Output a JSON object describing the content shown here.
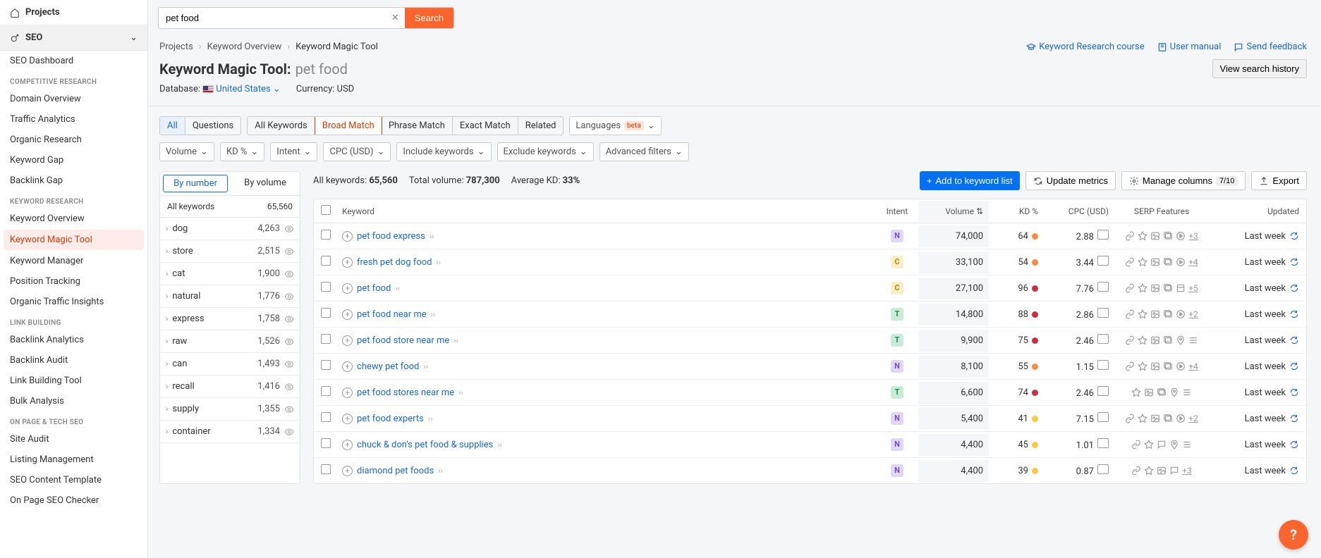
{
  "sidebar": {
    "projects_label": "Projects",
    "seo_label": "SEO",
    "items": {
      "dashboard": "SEO Dashboard",
      "sec_comp": "COMPETITIVE RESEARCH",
      "domain_ov": "Domain Overview",
      "traffic": "Traffic Analytics",
      "organic": "Organic Research",
      "kw_gap": "Keyword Gap",
      "bl_gap": "Backlink Gap",
      "sec_kw": "KEYWORD RESEARCH",
      "kw_ov": "Keyword Overview",
      "kw_magic": "Keyword Magic Tool",
      "kw_mgr": "Keyword Manager",
      "pos_track": "Position Tracking",
      "org_ins": "Organic Traffic Insights",
      "sec_lb": "LINK BUILDING",
      "bl_an": "Backlink Analytics",
      "bl_audit": "Backlink Audit",
      "lb_tool": "Link Building Tool",
      "bulk": "Bulk Analysis",
      "sec_op": "ON PAGE & TECH SEO",
      "site_audit": "Site Audit",
      "listing": "Listing Management",
      "seo_ct": "SEO Content Template",
      "op_checker": "On Page SEO Checker"
    }
  },
  "topbar": {
    "search_value": "pet food",
    "search_btn": "Search"
  },
  "crumbs": [
    "Projects",
    "Keyword Overview",
    "Keyword Magic Tool"
  ],
  "right_links": {
    "course": "Keyword Research course",
    "manual": "User manual",
    "feedback": "Send feedback"
  },
  "title": {
    "label": "Keyword Magic Tool:",
    "query": "pet food",
    "history_btn": "View search history"
  },
  "db": {
    "label": "Database:",
    "country": "United States",
    "currency_label": "Currency:",
    "currency": "USD"
  },
  "tabs1": {
    "all": "All",
    "questions": "Questions"
  },
  "tabs2": {
    "all_kw": "All Keywords",
    "broad": "Broad Match",
    "phrase": "Phrase Match",
    "exact": "Exact Match",
    "related": "Related"
  },
  "lang_chip": {
    "label": "Languages",
    "badge": "beta"
  },
  "filters": {
    "volume": "Volume",
    "kd": "KD %",
    "intent": "Intent",
    "cpc": "CPC (USD)",
    "include": "Include keywords",
    "exclude": "Exclude keywords",
    "advanced": "Advanced filters"
  },
  "left_panel": {
    "tab_number": "By number",
    "tab_volume": "By volume",
    "all_label": "All keywords",
    "all_count": "65,560",
    "rows": [
      {
        "term": "dog",
        "count": "4,263"
      },
      {
        "term": "store",
        "count": "2,515"
      },
      {
        "term": "cat",
        "count": "1,900"
      },
      {
        "term": "natural",
        "count": "1,776"
      },
      {
        "term": "express",
        "count": "1,758"
      },
      {
        "term": "raw",
        "count": "1,526"
      },
      {
        "term": "can",
        "count": "1,493"
      },
      {
        "term": "recall",
        "count": "1,416"
      },
      {
        "term": "supply",
        "count": "1,355"
      },
      {
        "term": "container",
        "count": "1,334"
      }
    ]
  },
  "stats": {
    "all_kw_label": "All keywords:",
    "all_kw": "65,560",
    "vol_label": "Total volume:",
    "vol": "787,300",
    "kd_label": "Average KD:",
    "kd": "33%"
  },
  "actions": {
    "add": "Add to keyword list",
    "update": "Update metrics",
    "manage": "Manage columns",
    "manage_count": "7/10",
    "export": "Export"
  },
  "thead": {
    "kw": "Keyword",
    "intent": "Intent",
    "vol": "Volume",
    "kd": "KD %",
    "cpc": "CPC (USD)",
    "serp": "SERP Features",
    "upd": "Updated"
  },
  "rows": [
    {
      "kw": "pet food express",
      "intent": "N",
      "vol": "74,000",
      "kd": "64",
      "kd_c": "orange",
      "cpc": "2.88",
      "serp": [
        "link",
        "star",
        "img",
        "img2",
        "vid"
      ],
      "serp_more": "+3",
      "upd": "Last week"
    },
    {
      "kw": "fresh pet dog food",
      "intent": "C",
      "vol": "33,100",
      "kd": "54",
      "kd_c": "orange",
      "cpc": "3.44",
      "serp": [
        "link",
        "star",
        "img",
        "img2",
        "vid"
      ],
      "serp_more": "+4",
      "upd": "Last week"
    },
    {
      "kw": "pet food",
      "intent": "C",
      "vol": "27,100",
      "kd": "96",
      "kd_c": "red",
      "cpc": "7.76",
      "serp": [
        "link",
        "star",
        "img",
        "img2",
        "box"
      ],
      "serp_more": "+5",
      "upd": "Last week"
    },
    {
      "kw": "pet food near me",
      "intent": "T",
      "vol": "14,800",
      "kd": "88",
      "kd_c": "red",
      "cpc": "2.86",
      "serp": [
        "link",
        "star",
        "img",
        "img2",
        "vid"
      ],
      "serp_more": "+2",
      "upd": "Last week"
    },
    {
      "kw": "pet food store near me",
      "intent": "T",
      "vol": "9,900",
      "kd": "75",
      "kd_c": "red",
      "cpc": "2.46",
      "serp": [
        "link",
        "star",
        "img",
        "img2",
        "pin",
        "list"
      ],
      "serp_more": "",
      "upd": "Last week"
    },
    {
      "kw": "chewy pet food",
      "intent": "N",
      "vol": "8,100",
      "kd": "55",
      "kd_c": "orange",
      "cpc": "1.15",
      "serp": [
        "link",
        "star",
        "img",
        "img2",
        "vid"
      ],
      "serp_more": "+4",
      "upd": "Last week"
    },
    {
      "kw": "pet food stores near me",
      "intent": "T",
      "vol": "6,600",
      "kd": "74",
      "kd_c": "red",
      "cpc": "2.46",
      "serp": [
        "star",
        "img",
        "img2",
        "pin",
        "list"
      ],
      "serp_more": "",
      "upd": "Last week"
    },
    {
      "kw": "pet food experts",
      "intent": "N",
      "vol": "5,400",
      "kd": "41",
      "kd_c": "yellow",
      "cpc": "7.15",
      "serp": [
        "link",
        "star",
        "img",
        "img2",
        "vid"
      ],
      "serp_more": "+2",
      "upd": "Last week"
    },
    {
      "kw": "chuck & don's pet food & supplies",
      "intent": "N",
      "vol": "4,400",
      "kd": "45",
      "kd_c": "yellow",
      "cpc": "1.01",
      "serp": [
        "link",
        "star",
        "chat",
        "pin",
        "list"
      ],
      "serp_more": "",
      "upd": "Last week"
    },
    {
      "kw": "diamond pet foods",
      "intent": "N",
      "vol": "4,400",
      "kd": "39",
      "kd_c": "yellow",
      "cpc": "0.87",
      "serp": [
        "link",
        "star",
        "img",
        "chat"
      ],
      "serp_more": "+3",
      "upd": "Last week"
    }
  ]
}
